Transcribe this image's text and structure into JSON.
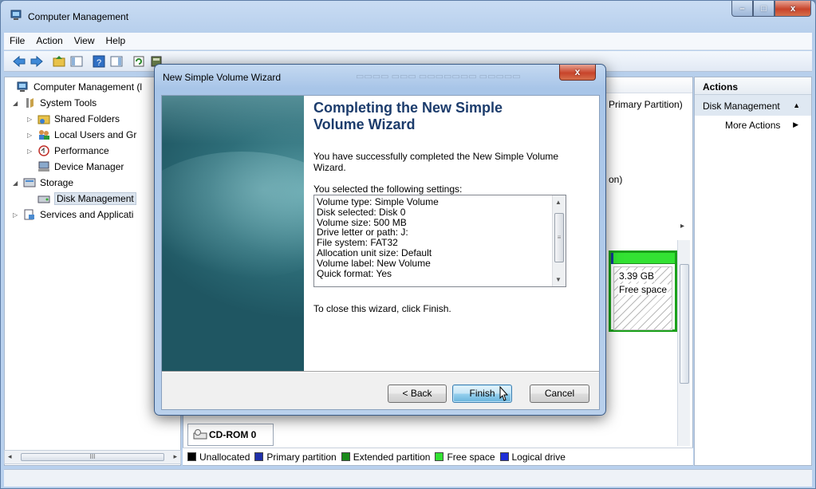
{
  "window": {
    "title": "Computer Management",
    "menu": [
      "File",
      "Action",
      "View",
      "Help"
    ],
    "caption_buttons": {
      "minimize": "–",
      "maximize": "□",
      "close": "x"
    }
  },
  "tree": {
    "items": [
      {
        "label": "Computer Management (l",
        "toggle": ""
      },
      {
        "label": "System Tools",
        "toggle": "◢"
      },
      {
        "label": "Shared Folders",
        "toggle": "▷"
      },
      {
        "label": "Local Users and Gr",
        "toggle": "▷"
      },
      {
        "label": "Performance",
        "toggle": "▷"
      },
      {
        "label": "Device Manager",
        "toggle": ""
      },
      {
        "label": "Storage",
        "toggle": "◢"
      },
      {
        "label": "Disk Management",
        "toggle": ""
      },
      {
        "label": "Services and Applicati",
        "toggle": "▷"
      }
    ],
    "scroll_left": "◂",
    "scroll_right": "▸",
    "scroll_grip": "III"
  },
  "center": {
    "fragment_primary": "Primary Partition)",
    "fragment_on": "on)",
    "disk_size": "3.39 GB",
    "disk_status": "Free space",
    "cdrom_label": "CD-ROM 0",
    "chevron": "▸"
  },
  "legend": [
    {
      "label": "Unallocated",
      "color": "#000000"
    },
    {
      "label": "Primary partition",
      "color": "#1f2fa8"
    },
    {
      "label": "Extended partition",
      "color": "#1a8a1a"
    },
    {
      "label": "Free space",
      "color": "#33e233"
    },
    {
      "label": "Logical drive",
      "color": "#1f2fd8"
    }
  ],
  "actions": {
    "header": "Actions",
    "section": "Disk Management",
    "section_arrow": "▲",
    "more": "More Actions",
    "more_arrow": "▶"
  },
  "dialog": {
    "title": "New Simple Volume Wizard",
    "close": "x",
    "heading": "Completing the New Simple Volume Wizard",
    "success_text": "You have successfully completed the New Simple Volume Wizard.",
    "settings_label": "You selected the following settings:",
    "settings": [
      "Volume type: Simple Volume",
      "Disk selected: Disk 0",
      "Volume size: 500 MB",
      "Drive letter or path: J:",
      "File system: FAT32",
      "Allocation unit size: Default",
      "Volume label: New Volume",
      "Quick format: Yes"
    ],
    "scroll_up": "▲",
    "scroll_down": "▼",
    "scroll_grip": "≡",
    "close_text": "To close this wizard, click Finish.",
    "buttons": {
      "back": "< Back",
      "finish": "Finish",
      "cancel": "Cancel"
    }
  }
}
